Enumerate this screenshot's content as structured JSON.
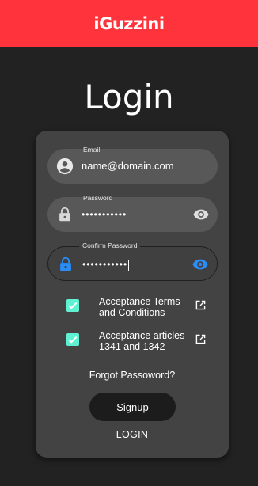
{
  "header": {
    "brand": "iGuzzini",
    "bar_color": "#ff333c"
  },
  "page": {
    "title": "Login"
  },
  "form": {
    "email": {
      "label": "Email",
      "value": "name@domain.com",
      "icon": "account-icon"
    },
    "password": {
      "label": "Password",
      "value": "•••••••••••",
      "icon": "lock-icon",
      "trailing_icon": "eye-icon"
    },
    "confirm_password": {
      "label": "Confirm Password",
      "value": "•••••••••••",
      "icon": "lock-icon",
      "trailing_icon": "eye-icon",
      "focused": true,
      "accent": "#2a8cf5"
    },
    "terms": {
      "label": "Acceptance Terms and Conditions",
      "checked": true,
      "icon": "external-link-icon"
    },
    "articles": {
      "label": "Acceptance articles 1341 and 1342",
      "checked": true,
      "icon": "external-link-icon"
    },
    "checkbox_color": "#5ff2d2",
    "forgot_label": "Forgot Passoword?",
    "signup_label": "Signup",
    "login_label": "LOGIN"
  }
}
